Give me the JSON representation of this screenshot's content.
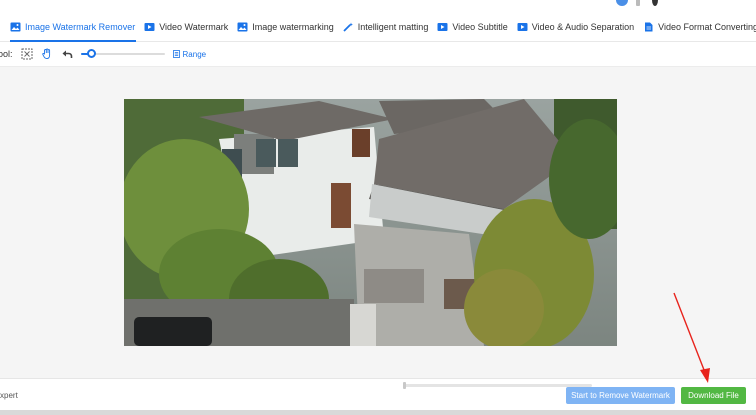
{
  "tabs": [
    {
      "label": "Image Watermark Remover",
      "icon": "image-icon",
      "active": true
    },
    {
      "label": "Video Watermark",
      "icon": "video-icon",
      "active": false
    },
    {
      "label": "Image watermarking",
      "icon": "image-icon",
      "active": false
    },
    {
      "label": "Intelligent matting",
      "icon": "magic-wand-icon",
      "active": false
    },
    {
      "label": "Video Subtitle",
      "icon": "video-icon",
      "active": false
    },
    {
      "label": "Video & Audio Separation",
      "icon": "video-icon",
      "active": false
    },
    {
      "label": "Video Format Converting",
      "icon": "file-icon",
      "active": false
    }
  ],
  "toolbar": {
    "tool_label": "ool:",
    "brush_size_level": 0.12,
    "range_label": "Range"
  },
  "bottom": {
    "mode_label": "xpert",
    "remove_button": "Start to Remove Watermark",
    "download_button": "Download File"
  },
  "colors": {
    "accent": "#1a73e8",
    "remove_button": "#7fb4f4",
    "download_button": "#52b843",
    "annotation_arrow": "#e8231c"
  }
}
